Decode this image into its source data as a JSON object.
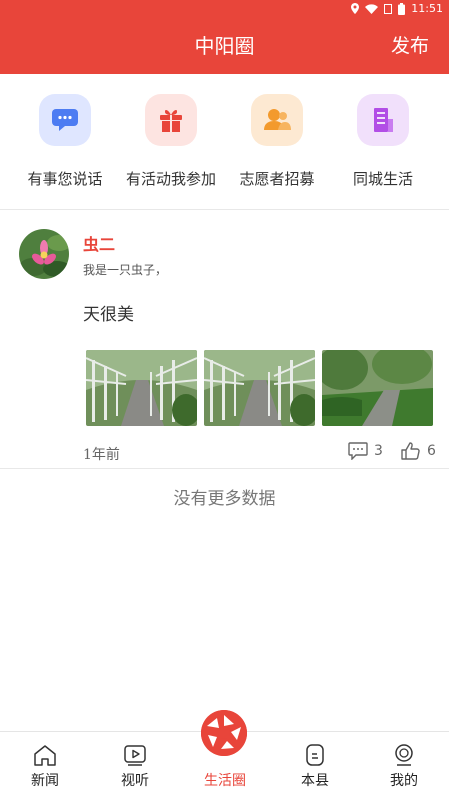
{
  "status_bar": {
    "time": "11:51"
  },
  "header": {
    "title": "中阳圈",
    "publish_label": "发布"
  },
  "quick_actions": [
    {
      "label": "有事您说话",
      "icon": "chat-icon",
      "bg": "#dfe6ff",
      "fg": "#4d7cf2"
    },
    {
      "label": "有活动我参加",
      "icon": "gift-icon",
      "bg": "#fde4e1",
      "fg": "#e8453a"
    },
    {
      "label": "志愿者招募",
      "icon": "volunteer-icon",
      "bg": "#fde9d2",
      "fg": "#f39a2d"
    },
    {
      "label": "同城生活",
      "icon": "building-icon",
      "bg": "#f1e0fb",
      "fg": "#b24ee6"
    }
  ],
  "post": {
    "username": "虫二",
    "bio": "我是一只虫子，",
    "content": "天很美",
    "time": "1年前",
    "comments": "3",
    "likes": "6"
  },
  "feed_end": "没有更多数据",
  "tabs": [
    {
      "label": "新闻",
      "icon": "home-icon",
      "active": false
    },
    {
      "label": "视听",
      "icon": "video-icon",
      "active": false
    },
    {
      "label": "生活圈",
      "icon": "aperture-icon",
      "active": true
    },
    {
      "label": "本县",
      "icon": "county-icon",
      "active": false
    },
    {
      "label": "我的",
      "icon": "profile-icon",
      "active": false
    }
  ],
  "colors": {
    "accent": "#e8453a"
  }
}
